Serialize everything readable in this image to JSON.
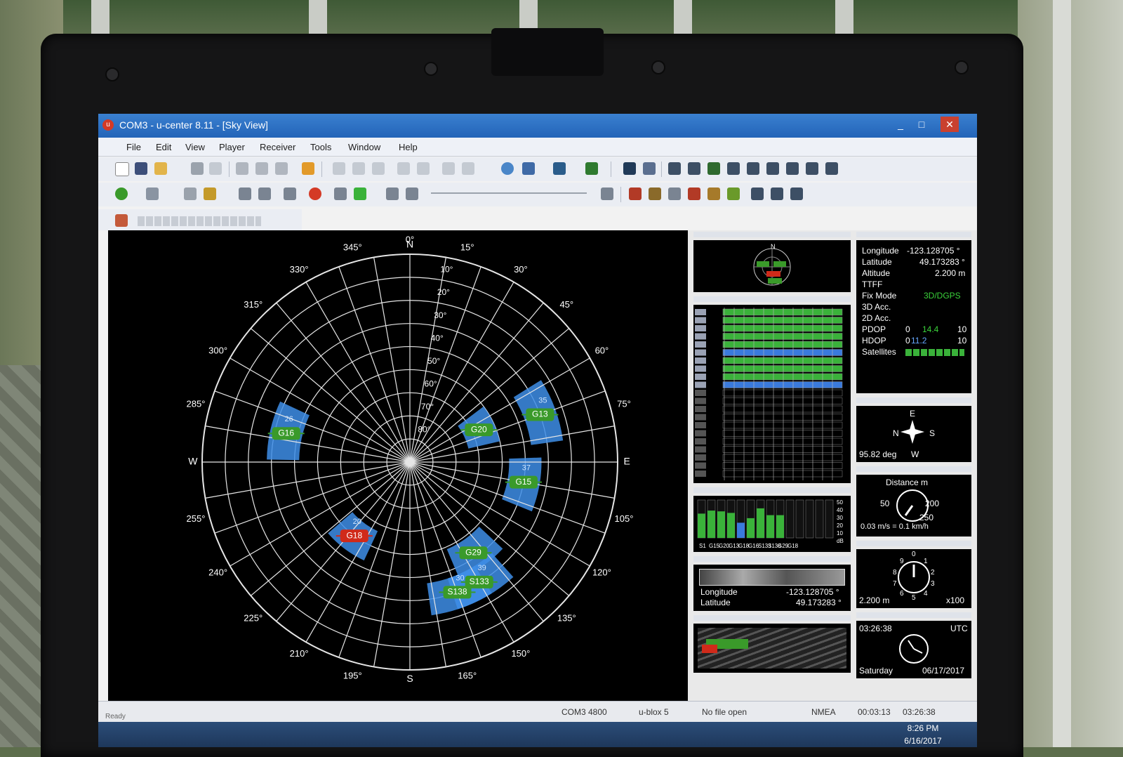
{
  "window": {
    "title": "COM3 - u-center 8.11 - [Sky View]",
    "controls": [
      "_",
      "□",
      "✕"
    ]
  },
  "menu": [
    "File",
    "Edit",
    "View",
    "Player",
    "Receiver",
    "Tools",
    "Window",
    "Help"
  ],
  "sky_view": {
    "north": "N",
    "south": "S",
    "east": "E",
    "west": "W",
    "azimuth_labels": [
      "0°",
      "15°",
      "30°",
      "45°",
      "60°",
      "75°",
      "105°",
      "120°",
      "135°",
      "150°",
      "165°",
      "195°",
      "210°",
      "225°",
      "240°",
      "255°",
      "285°",
      "300°",
      "315°",
      "330°",
      "345°"
    ],
    "elevation_labels": [
      "10°",
      "20°",
      "30°",
      "40°",
      "50°",
      "60°",
      "70°",
      "80°"
    ],
    "satellites": [
      {
        "id": "G16",
        "az": 283,
        "el": 35,
        "cno": "26",
        "color": "#3a9a2a"
      },
      {
        "id": "G20",
        "az": 65,
        "el": 57,
        "cno": "",
        "color": "#3a9a2a"
      },
      {
        "id": "G13",
        "az": 70,
        "el": 30,
        "cno": "35",
        "color": "#3a9a2a"
      },
      {
        "id": "G15",
        "az": 100,
        "el": 40,
        "cno": "37",
        "color": "#3a9a2a"
      },
      {
        "id": "G18",
        "az": 217,
        "el": 50,
        "cno": "20",
        "color": "#d02a1a"
      },
      {
        "id": "G29",
        "az": 145,
        "el": 42,
        "cno": "",
        "color": "#3a9a2a"
      },
      {
        "id": "S138",
        "az": 160,
        "el": 30,
        "cno": "30",
        "color": "#3a9a2a"
      },
      {
        "id": "S133",
        "az": 150,
        "el": 30,
        "cno": "39",
        "color": "#3a9a2a"
      }
    ]
  },
  "data_panel": {
    "rows": [
      {
        "label": "Longitude",
        "value": "-123.128705 °"
      },
      {
        "label": "Latitude",
        "value": "49.173283 °"
      },
      {
        "label": "Altitude",
        "value": "2.200 m"
      },
      {
        "label": "TTFF",
        "value": ""
      },
      {
        "label": "Fix Mode",
        "value": "3D/DGPS"
      },
      {
        "label": "3D Acc.",
        "value": ""
      },
      {
        "label": "2D Acc.",
        "value": ""
      },
      {
        "label": "PDOP",
        "value": "14.4"
      },
      {
        "label": "HDOP",
        "value": "11.2"
      },
      {
        "label": "Satellites",
        "value": ""
      }
    ],
    "scale_min": "0",
    "scale_max": "10",
    "fix_color": "#3ad23a"
  },
  "compass": {
    "e": "E",
    "n": "N",
    "s": "S",
    "w": "W",
    "heading": "95.82 deg"
  },
  "speed": {
    "title": "Distance m",
    "l50": "50",
    "l200": "200",
    "l250": "250",
    "speed": "0.03 m/s = 0.1 km/h"
  },
  "altimeter": {
    "value": "2.200 m",
    "unit": "x100",
    "digits": [
      "0",
      "1",
      "2",
      "3",
      "4",
      "5",
      "6",
      "7",
      "8",
      "9"
    ]
  },
  "clock_panel": {
    "time": "03:26:38",
    "zone": "UTC",
    "day": "Saturday",
    "date": "06/17/2017"
  },
  "map_panel": {
    "lon_label": "Longitude",
    "lon_value": "-123.128705 °",
    "lat_label": "Latitude",
    "lat_value": "49.173283 °"
  },
  "signal_panel": {
    "ids": [
      "S1",
      "G15",
      "G20",
      "G13",
      "G18",
      "G16",
      "S133",
      "S138",
      "G29",
      "G18"
    ],
    "levels_db": [
      32,
      36,
      35,
      33,
      20,
      26,
      39,
      30,
      30,
      0
    ],
    "scale": [
      "50",
      "40",
      "30",
      "20",
      "10",
      "dB"
    ]
  },
  "status": {
    "ready": "Ready",
    "port": "COM3 4800",
    "receiver": "u-blox 5",
    "file": "No file open",
    "protocol": "NMEA",
    "elapsed": "00:03:13",
    "utc": "03:26:38"
  },
  "taskbar": {
    "time": "8:26 PM",
    "date": "6/16/2017"
  }
}
